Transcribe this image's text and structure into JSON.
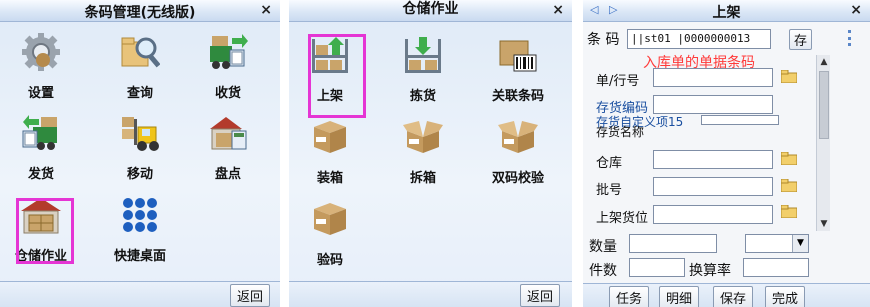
{
  "panel1": {
    "title": "条码管理(无线版)",
    "close": "×",
    "tiles": [
      {
        "label": "设置",
        "icon": "gear-icon"
      },
      {
        "label": "查询",
        "icon": "magnifier-folder-icon"
      },
      {
        "label": "收货",
        "icon": "receive-truck-icon"
      },
      {
        "label": "发货",
        "icon": "ship-truck-icon"
      },
      {
        "label": "移动",
        "icon": "forklift-icon"
      },
      {
        "label": "盘点",
        "icon": "warehouse-count-icon"
      },
      {
        "label": "仓储作业",
        "icon": "warehouse-icon"
      },
      {
        "label": "快捷桌面",
        "icon": "grid-dots-icon"
      }
    ],
    "back": "返回"
  },
  "panel2": {
    "title": "仓储作业",
    "close": "×",
    "tiles": [
      {
        "label": "上架",
        "icon": "shelf-up-icon"
      },
      {
        "label": "拣货",
        "icon": "shelf-down-icon"
      },
      {
        "label": "关联条码",
        "icon": "box-barcode-icon"
      },
      {
        "label": "装箱",
        "icon": "box-icon"
      },
      {
        "label": "拆箱",
        "icon": "open-box-icon"
      },
      {
        "label": "双码校验",
        "icon": "open-box-icon"
      },
      {
        "label": "验码",
        "icon": "box-icon"
      }
    ],
    "back": "返回"
  },
  "panel3": {
    "title": "上架",
    "close": "×",
    "nav_prev": "◁",
    "nav_next": "▷",
    "barcode_label": "条 码",
    "barcode_value": "||st01 |0000000013",
    "save_small": "存",
    "annotation": "入库单的单据条码",
    "fields": [
      {
        "label": "单/行号",
        "value": ""
      },
      {
        "label": "存货编码",
        "value": ""
      },
      {
        "label": "存货自定义项15",
        "value": ""
      },
      {
        "label": "存货名称",
        "value": ""
      },
      {
        "label": "仓库",
        "value": ""
      },
      {
        "label": "批号",
        "value": ""
      },
      {
        "label": "上架货位",
        "value": ""
      }
    ],
    "qty_label": "数量",
    "pieces_label": "件数",
    "rate_label": "换算率",
    "buttons": {
      "task": "任务",
      "detail": "明细",
      "save": "保存",
      "done": "完成"
    },
    "accent": "#1a4fa0"
  }
}
